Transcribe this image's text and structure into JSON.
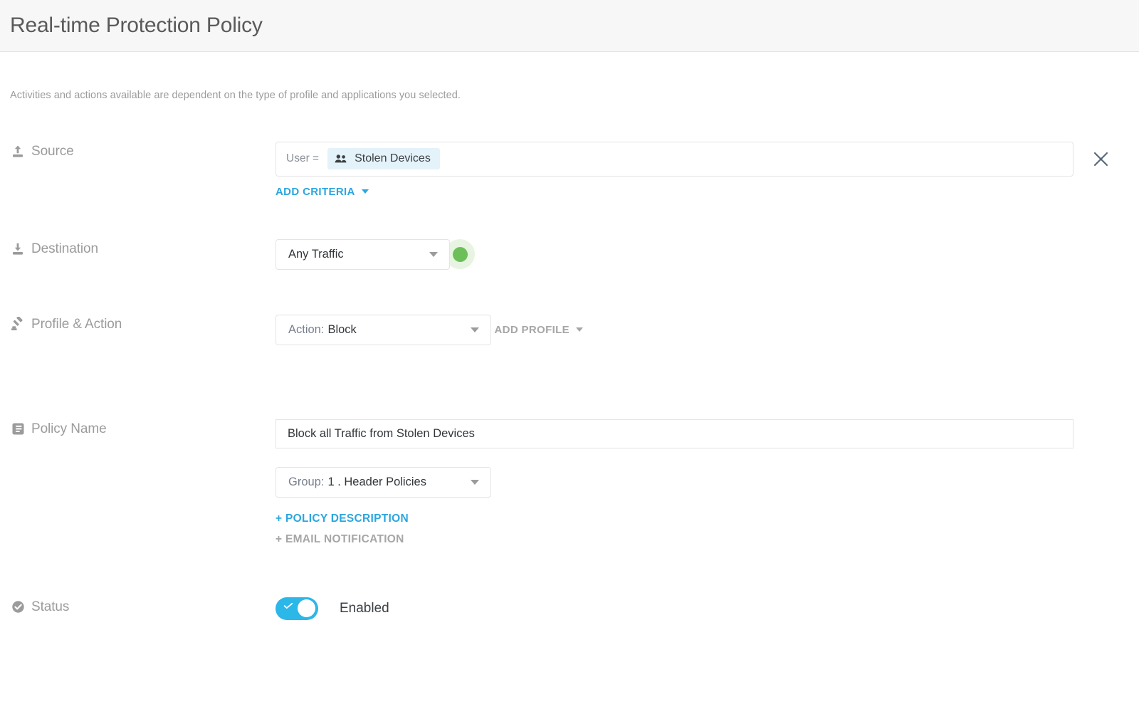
{
  "header": {
    "title": "Real-time Protection Policy"
  },
  "intro": {
    "text": "Activities and actions available are dependent on the type of profile and applications you selected."
  },
  "colors": {
    "accent_blue": "#2ba6de",
    "toggle_on": "#2bb7e8",
    "status_green": "#6cbf59",
    "status_green_halo": "#e7f4e2",
    "chip_bg": "#e4f2fa",
    "label_gray": "#9b9b9b",
    "header_bg": "#f7f7f8"
  },
  "source": {
    "label": "Source",
    "icon": "upload-icon",
    "criteria_key": "User =",
    "chip": {
      "icon": "people-group-icon",
      "label": "Stolen Devices"
    },
    "remove_icon": "close-icon",
    "add_criteria_label": "ADD CRITERIA",
    "caret_icon": "caret-down-icon"
  },
  "destination": {
    "label": "Destination",
    "icon": "download-icon",
    "select_value": "Any Traffic",
    "status_dot": "green",
    "caret_icon": "caret-down-icon"
  },
  "profile_action": {
    "label": "Profile & Action",
    "icon": "gavel-icon",
    "action_prefix": "Action:",
    "action_value": "Block",
    "add_profile_label": "ADD PROFILE",
    "caret_icon": "caret-down-icon"
  },
  "policy_name": {
    "label": "Policy Name",
    "icon": "document-lines-icon",
    "name_value": "Block all Traffic from Stolen Devices",
    "name_placeholder": "Policy Name",
    "group_prefix": "Group:",
    "group_value": "1 . Header Policies",
    "policy_description_label": "+ POLICY DESCRIPTION",
    "email_notification_label": "+ EMAIL NOTIFICATION",
    "caret_icon": "caret-down-icon"
  },
  "status": {
    "label": "Status",
    "icon": "check-circle-icon",
    "toggle_on": true,
    "toggle_text": "Enabled"
  }
}
